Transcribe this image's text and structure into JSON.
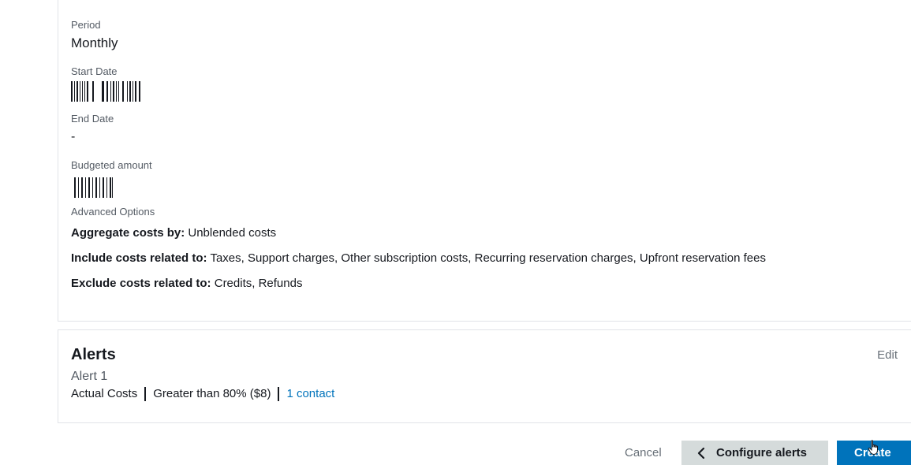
{
  "budget_details": {
    "period": {
      "label": "Period",
      "value": "Monthly"
    },
    "start_date": {
      "label": "Start Date"
    },
    "end_date": {
      "label": "End Date",
      "value": "-"
    },
    "budgeted_amount": {
      "label": "Budgeted amount"
    },
    "advanced_options": {
      "label": "Advanced Options",
      "aggregate": {
        "key": "Aggregate costs by:",
        "value": "Unblended costs"
      },
      "include": {
        "key": "Include costs related to:",
        "value": "Taxes, Support charges, Other subscription costs, Recurring reservation charges, Upfront reservation fees"
      },
      "exclude": {
        "key": "Exclude costs related to:",
        "value": "Credits, Refunds"
      }
    }
  },
  "alerts": {
    "title": "Alerts",
    "edit_label": "Edit",
    "items": [
      {
        "name": "Alert 1",
        "type": "Actual Costs",
        "threshold": "Greater than 80% ($8)",
        "contacts": "1 contact"
      }
    ]
  },
  "footer": {
    "cancel_label": "Cancel",
    "back_label": "Configure alerts",
    "create_label": "Create"
  },
  "colors": {
    "primary": "#0073bb",
    "secondary_button": "#d5dbdb",
    "link": "#0073bb",
    "muted_text": "#687078"
  },
  "icons": {
    "back": "chevron-left-icon",
    "pointer": "hand-pointer-icon"
  }
}
